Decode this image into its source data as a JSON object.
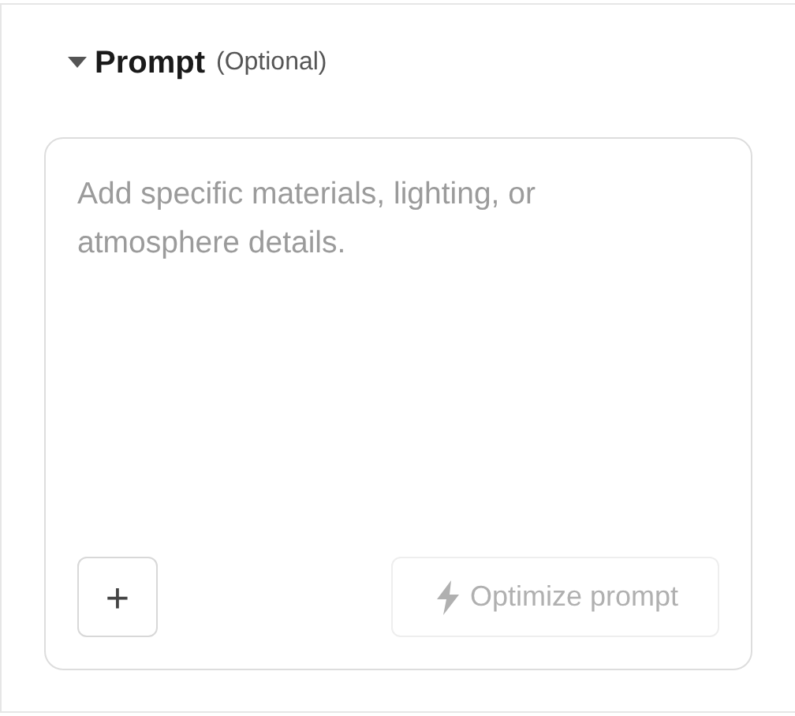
{
  "section": {
    "title": "Prompt",
    "subtitle": "(Optional)",
    "expanded": true
  },
  "prompt": {
    "placeholder": "Add specific materials, lighting, or atmosphere details."
  },
  "add_button": {
    "label": "+"
  },
  "optimize_button": {
    "label": "Optimize prompt",
    "disabled": true
  }
}
